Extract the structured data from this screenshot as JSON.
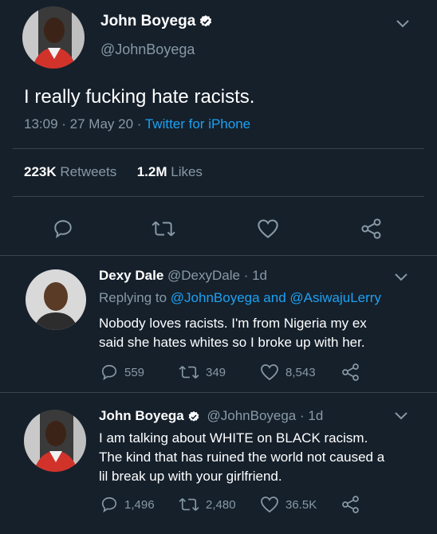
{
  "main_tweet": {
    "name": "John Boyega",
    "handle": "@JohnBoyega",
    "text": "I really fucking hate racists.",
    "time": "13:09 · 27 May 20 · ",
    "source": "Twitter for iPhone",
    "retweets_count": "223K",
    "retweets_label": "Retweets",
    "likes_count": "1.2M",
    "likes_label": "Likes"
  },
  "reply1": {
    "name": "Dexy Dale",
    "handle": "@DexyDale",
    "time": " · 1d",
    "replying_prefix": "Replying to ",
    "replying_to_1": "@JohnBoyega",
    "replying_and": " and ",
    "replying_to_2": "@AsiwajuLerry",
    "text_line1": "Nobody loves racists. I'm from Nigeria my ex",
    "text_line2": "said she hates whites so I broke up with her.",
    "replies": "559",
    "retweets": "349",
    "likes": "8,543"
  },
  "reply2": {
    "name": "John Boyega",
    "handle": "@JohnBoyega",
    "time": " · 1d",
    "text_line1": "I am talking about WHITE on BLACK racism.",
    "text_line2": "The kind that has ruined the world not caused a",
    "text_line3": "lil break up with your girlfriend.",
    "replies": "1,496",
    "retweets": "2,480",
    "likes": "36.5K"
  },
  "colors": {
    "background": "#15202b",
    "accent": "#1da1f2",
    "muted": "#8899a6",
    "divider": "#38444d"
  },
  "icons": [
    "verified-badge-icon",
    "chevron-down-icon",
    "reply-icon",
    "retweet-icon",
    "like-icon",
    "share-icon"
  ]
}
